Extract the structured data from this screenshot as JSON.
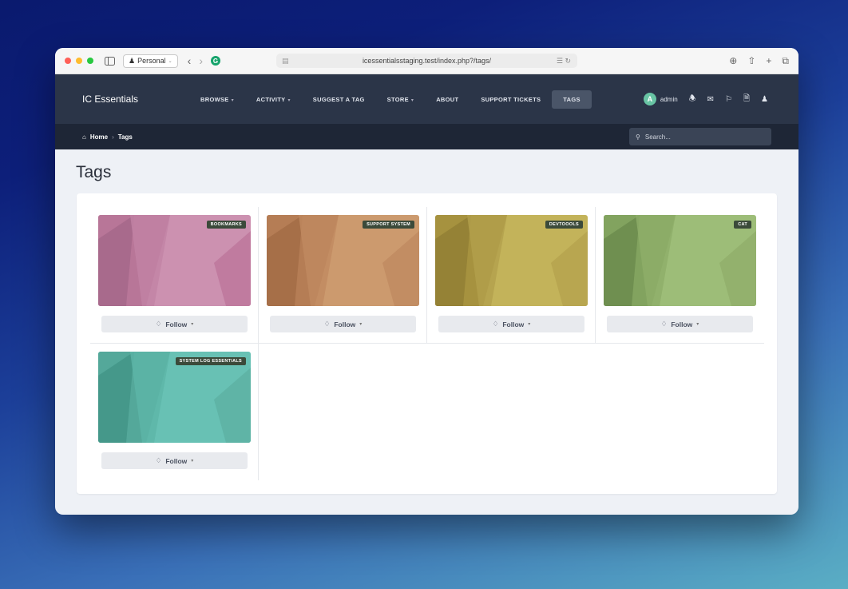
{
  "browser": {
    "profile": "Personal",
    "url": "icessentialsstaging.test/index.php?/tags/"
  },
  "site": {
    "brand": "IC Essentials",
    "nav": [
      {
        "label": "BROWSE",
        "dropdown": true
      },
      {
        "label": "ACTIVITY",
        "dropdown": true
      },
      {
        "label": "SUGGEST A TAG",
        "dropdown": false
      },
      {
        "label": "STORE",
        "dropdown": true
      },
      {
        "label": "ABOUT",
        "dropdown": false
      },
      {
        "label": "SUPPORT TICKETS",
        "dropdown": false
      },
      {
        "label": "TAGS",
        "dropdown": false,
        "active": true
      }
    ],
    "user": {
      "initial": "A",
      "name": "admin",
      "avatar_color": "#68c4a4"
    }
  },
  "breadcrumb": {
    "home": "Home",
    "separator": "›",
    "current": "Tags"
  },
  "search": {
    "placeholder": "Search..."
  },
  "page": {
    "title": "Tags"
  },
  "tags": [
    {
      "name": "BOOKMARKS",
      "follow_label": "Follow",
      "color": "#c98aa8"
    },
    {
      "name": "SUPPORT SYSTEM",
      "follow_label": "Follow",
      "color": "#c9956a"
    },
    {
      "name": "DEVTOOOLS",
      "follow_label": "Follow",
      "color": "#b9a855"
    },
    {
      "name": "CAT",
      "follow_label": "Follow",
      "color": "#8eb16e"
    },
    {
      "name": "SYSTEM LOG ESSENTIALS",
      "follow_label": "Follow",
      "color": "#5fb7ab"
    }
  ]
}
